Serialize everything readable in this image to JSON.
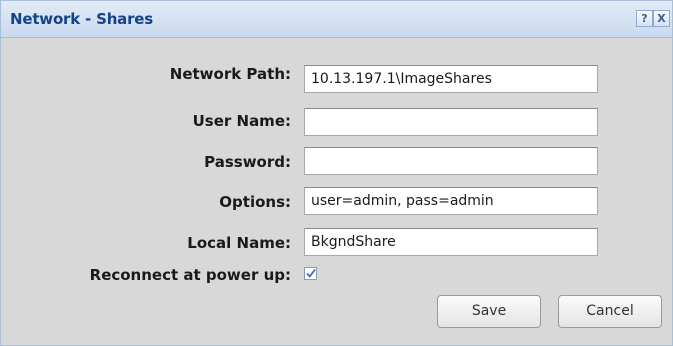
{
  "dialog": {
    "title": "Network - Shares",
    "help_label": "?",
    "close_label": "X"
  },
  "form": {
    "network_path_label": "Network Path:",
    "network_path_value": "10.13.197.1\\ImageShares",
    "user_name_label": "User Name:",
    "user_name_value": "",
    "password_label": "Password:",
    "password_value": "",
    "options_label": "Options:",
    "options_value": "user=admin, pass=admin",
    "local_name_label": "Local Name:",
    "local_name_value": "BkgndShare",
    "reconnect_label": "Reconnect at power up:",
    "reconnect_checked": true
  },
  "buttons": {
    "save_label": "Save",
    "cancel_label": "Cancel"
  },
  "icons": {
    "help": "help-icon",
    "close": "close-icon",
    "check": "checkmark-icon"
  },
  "colors": {
    "title_text": "#15428b",
    "titlebar_top": "#e3ecf7",
    "titlebar_bottom": "#c9d9ee",
    "panel_bg": "#d8d8d8",
    "checkmark": "#3d6fb8"
  }
}
